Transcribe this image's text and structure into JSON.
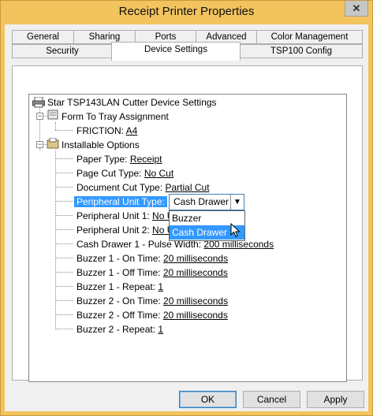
{
  "window": {
    "title": "Receipt Printer Properties",
    "close_glyph": "✕"
  },
  "tabs": {
    "row1": [
      "General",
      "Sharing",
      "Ports",
      "Advanced",
      "Color Management"
    ],
    "row2": [
      "Security",
      "Device Settings",
      "TSP100 Config"
    ],
    "active": "Device Settings"
  },
  "tree": {
    "root": "Star TSP143LAN Cutter Device Settings",
    "form_to_tray": "Form To Tray Assignment",
    "friction": {
      "label": "FRICTION: ",
      "value": "A4"
    },
    "installable": "Installable Options",
    "items": [
      {
        "label": "Paper Type: ",
        "value": "Receipt"
      },
      {
        "label": "Page Cut Type: ",
        "value": "No Cut"
      },
      {
        "label": "Document Cut Type: ",
        "value": "Partial Cut"
      },
      {
        "label": "Peripheral Unit Type:",
        "value": ""
      },
      {
        "label": "Peripheral Unit 1: ",
        "value": "No U"
      },
      {
        "label": "Peripheral Unit 2: ",
        "value": "No U"
      },
      {
        "label": "Cash Drawer 1 - Pulse Width: ",
        "value": "200 milliseconds"
      },
      {
        "label": "Buzzer 1 - On Time: ",
        "value": "20 milliseconds"
      },
      {
        "label": "Buzzer 1 - Off Time: ",
        "value": "20 milliseconds"
      },
      {
        "label": "Buzzer 1 - Repeat: ",
        "value": "1"
      },
      {
        "label": "Buzzer 2 - On Time: ",
        "value": "20 milliseconds"
      },
      {
        "label": "Buzzer 2 - Off Time: ",
        "value": "20 milliseconds"
      },
      {
        "label": "Buzzer 2 - Repeat: ",
        "value": "1"
      }
    ]
  },
  "combo": {
    "selected": "Cash Drawer",
    "arrow": "▼",
    "options": [
      "Buzzer",
      "Cash Drawer"
    ],
    "highlighted": "Cash Drawer"
  },
  "buttons": {
    "ok": "OK",
    "cancel": "Cancel",
    "apply": "Apply"
  },
  "colors": {
    "frame": "#f3c35e",
    "selection": "#3399ff"
  }
}
